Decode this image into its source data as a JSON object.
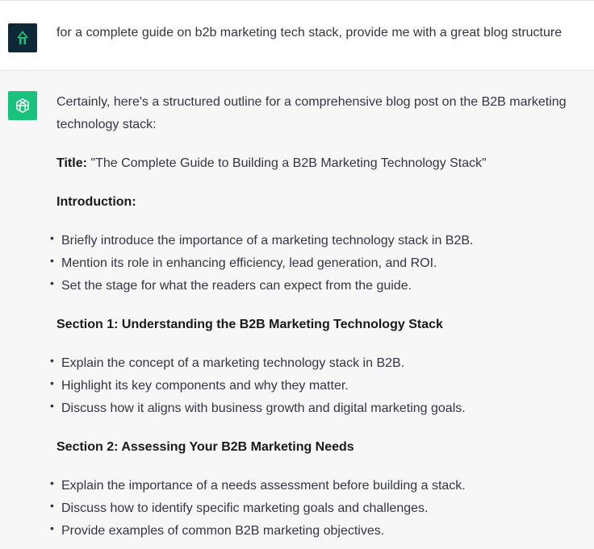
{
  "user_message": {
    "avatar_icon": "user-logo-icon",
    "text": "for a complete guide on b2b marketing tech stack, provide me with a great blog structure"
  },
  "assistant_message": {
    "avatar_icon": "chatgpt-logo-icon",
    "intro": "Certainly, here's a structured outline for a comprehensive blog post on the B2B marketing technology stack:",
    "title_label": "Title:",
    "title_text": " \"The Complete Guide to Building a B2B Marketing Technology Stack\"",
    "introduction_heading": "Introduction:",
    "introduction_items": [
      "Briefly introduce the importance of a marketing technology stack in B2B.",
      "Mention its role in enhancing efficiency, lead generation, and ROI.",
      "Set the stage for what the readers can expect from the guide."
    ],
    "section1_heading": "Section 1: Understanding the B2B Marketing Technology Stack",
    "section1_items": [
      "Explain the concept of a marketing technology stack in B2B.",
      "Highlight its key components and why they matter.",
      "Discuss how it aligns with business growth and digital marketing goals."
    ],
    "section2_heading": "Section 2: Assessing Your B2B Marketing Needs",
    "section2_items": [
      "Explain the importance of a needs assessment before building a stack.",
      "Discuss how to identify specific marketing goals and challenges.",
      "Provide examples of common B2B marketing objectives."
    ]
  },
  "colors": {
    "user_avatar_bg": "#0f2838",
    "user_avatar_glyph": "#19c37d",
    "assistant_avatar_bg": "#19c37d",
    "assistant_bg": "#f7f7f8"
  }
}
